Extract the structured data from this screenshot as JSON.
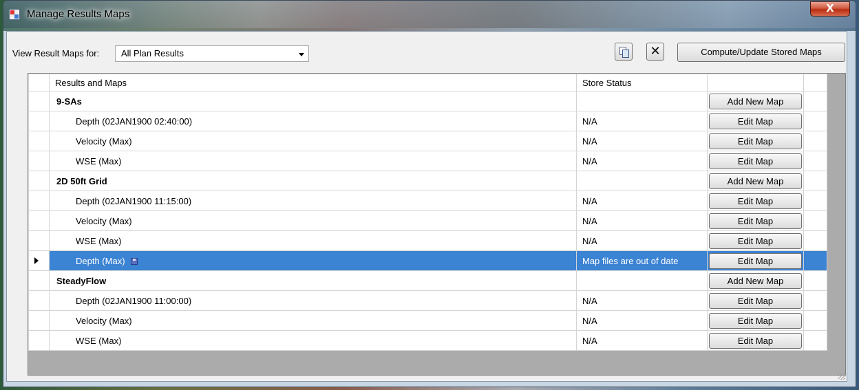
{
  "window": {
    "title": "Manage Results Maps",
    "close_glyph": "X"
  },
  "toolbar": {
    "view_label": "View Result Maps for:",
    "view_value": "All Plan Results",
    "copy_icon": "copy-icon",
    "clear_icon": "clear-icon",
    "clear_glyph": "✕",
    "compute_label": "Compute/Update Stored Maps"
  },
  "table": {
    "headers": [
      "Results and Maps",
      "Store Status",
      ""
    ],
    "rows": [
      {
        "type": "group",
        "name": "9-SAs",
        "status": "",
        "action": "Add New Map"
      },
      {
        "type": "child",
        "name": "Depth (02JAN1900 02:40:00)",
        "status": "N/A",
        "action": "Edit Map"
      },
      {
        "type": "child",
        "name": "Velocity (Max)",
        "status": "N/A",
        "action": "Edit Map"
      },
      {
        "type": "child",
        "name": "WSE (Max)",
        "status": "N/A",
        "action": "Edit Map"
      },
      {
        "type": "group",
        "name": "2D 50ft Grid",
        "status": "",
        "action": "Add New Map"
      },
      {
        "type": "child",
        "name": "Depth (02JAN1900 11:15:00)",
        "status": "N/A",
        "action": "Edit Map"
      },
      {
        "type": "child",
        "name": "Velocity (Max)",
        "status": "N/A",
        "action": "Edit Map"
      },
      {
        "type": "child",
        "name": "WSE (Max)",
        "status": "N/A",
        "action": "Edit Map"
      },
      {
        "type": "child",
        "name": "Depth (Max)",
        "status": "Map files are out of date",
        "action": "Edit Map",
        "selected": true,
        "stored_icon": "save-icon"
      },
      {
        "type": "group",
        "name": "SteadyFlow",
        "status": "",
        "action": "Add New Map"
      },
      {
        "type": "child",
        "name": "Depth (02JAN1900 11:00:00)",
        "status": "N/A",
        "action": "Edit Map"
      },
      {
        "type": "child",
        "name": "Velocity (Max)",
        "status": "N/A",
        "action": "Edit Map"
      },
      {
        "type": "child",
        "name": "WSE (Max)",
        "status": "N/A",
        "action": "Edit Map"
      }
    ]
  },
  "colors": {
    "selection": "#3b83d3",
    "grid_background": "#ababab"
  }
}
